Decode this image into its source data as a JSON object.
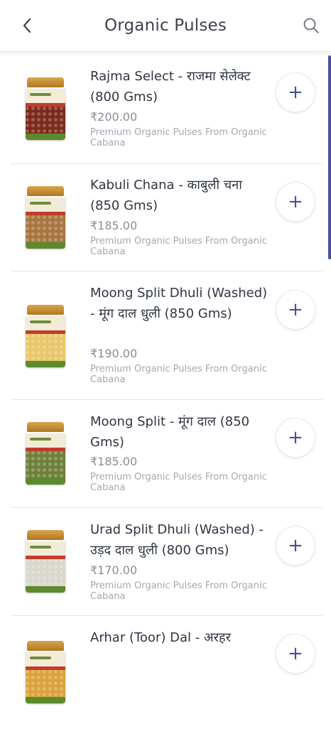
{
  "header": {
    "title": "Organic Pulses",
    "back_icon": "chevron-left-icon",
    "search_icon": "search-icon"
  },
  "colors": {
    "accent": "#4b4f91",
    "text": "#2f3542",
    "muted": "#8a8d96"
  },
  "products": [
    {
      "name": "Rajma Select - राजमा सेलेक्ट (800 Gms)",
      "price": "₹200.00",
      "description": "Premium Organic Pulses From Organic Cabana",
      "add_label": "+",
      "pulse_color": "#7a2a1c"
    },
    {
      "name": "Kabuli Chana - काबुली चना (850 Gms)",
      "price": "₹185.00",
      "description": "Premium Organic Pulses From Organic Cabana",
      "add_label": "+",
      "pulse_color": "#a8743f"
    },
    {
      "name": "Moong Split Dhuli (Washed) - मूंग दाल धुली (850 Gms)",
      "price": "₹190.00",
      "description": "Premium Organic Pulses From Organic Cabana",
      "add_label": "+",
      "pulse_color": "#e7c76a"
    },
    {
      "name": "Moong Split - मूंग दाल (850 Gms)",
      "price": "₹185.00",
      "description": "Premium Organic Pulses From Organic Cabana",
      "add_label": "+",
      "pulse_color": "#6f7f3a"
    },
    {
      "name": "Urad Split Dhuli (Washed) - उड़द दाल धुली (800 Gms)",
      "price": "₹170.00",
      "description": "Premium Organic Pulses From Organic Cabana",
      "add_label": "+",
      "pulse_color": "#d9d6cc"
    },
    {
      "name": "Arhar (Toor) Dal - अरहर",
      "price": "",
      "description": "",
      "add_label": "+",
      "pulse_color": "#d9a23a"
    }
  ]
}
